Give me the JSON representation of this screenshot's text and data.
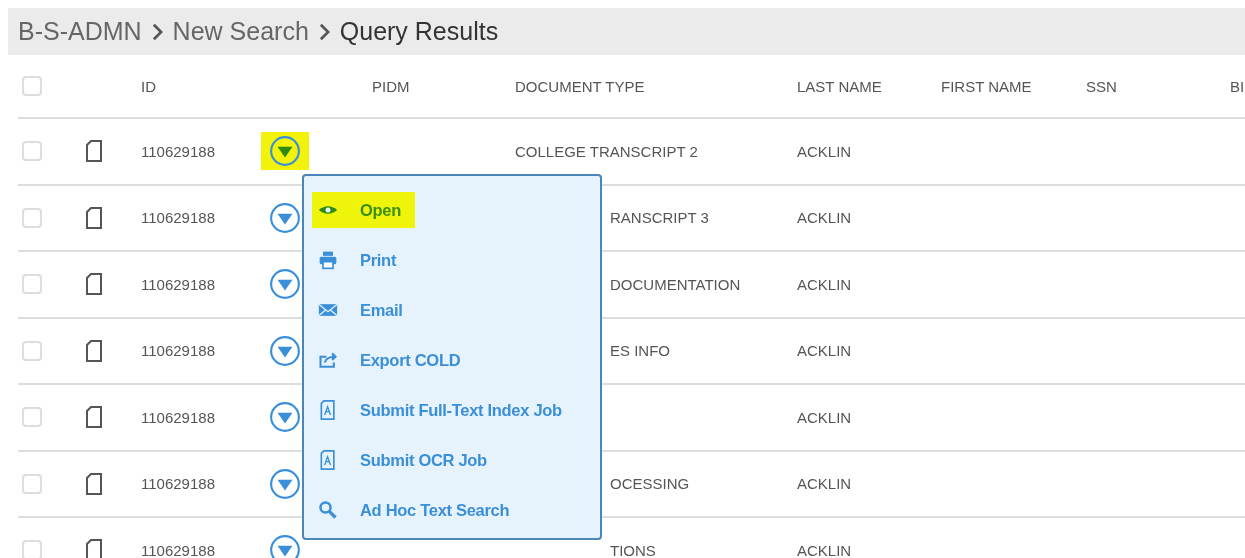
{
  "breadcrumb": [
    "B-S-ADMN",
    "New Search",
    "Query Results"
  ],
  "table": {
    "all_checked": false,
    "columns": [
      "ID",
      "PIDM",
      "DOCUMENT TYPE",
      "LAST NAME",
      "FIRST NAME",
      "SSN",
      "BI"
    ],
    "rows": [
      {
        "id": "110629188",
        "document_type": "COLLEGE TRANSCRIPT 2",
        "last_name": "ACKLIN",
        "selected": true,
        "checked": false
      },
      {
        "id": "110629188",
        "document_type": "RANSCRIPT 3",
        "last_name": "ACKLIN",
        "selected": false,
        "checked": false
      },
      {
        "id": "110629188",
        "document_type": "DOCUMENTATION",
        "last_name": "ACKLIN",
        "selected": false,
        "checked": false
      },
      {
        "id": "110629188",
        "document_type": "ES INFO",
        "last_name": "ACKLIN",
        "selected": false,
        "checked": false
      },
      {
        "id": "110629188",
        "last_name": "ACKLIN",
        "selected": false,
        "checked": false
      },
      {
        "id": "110629188",
        "document_type": "OCESSING",
        "last_name": "ACKLIN",
        "selected": false,
        "checked": false
      },
      {
        "id": "110629188",
        "document_type": "TIONS",
        "last_name": "ACKLIN",
        "selected": false,
        "checked": false
      }
    ]
  },
  "menu": {
    "items": [
      {
        "label": "Open",
        "selected": true
      },
      {
        "label": "Print",
        "selected": false
      },
      {
        "label": "Email",
        "selected": false
      },
      {
        "label": "Export COLD",
        "selected": false
      },
      {
        "label": "Submit Full-Text Index Job",
        "selected": false
      },
      {
        "label": "Submit OCR Job",
        "selected": false
      },
      {
        "label": "Ad Hoc Text Search",
        "selected": false
      }
    ]
  }
}
